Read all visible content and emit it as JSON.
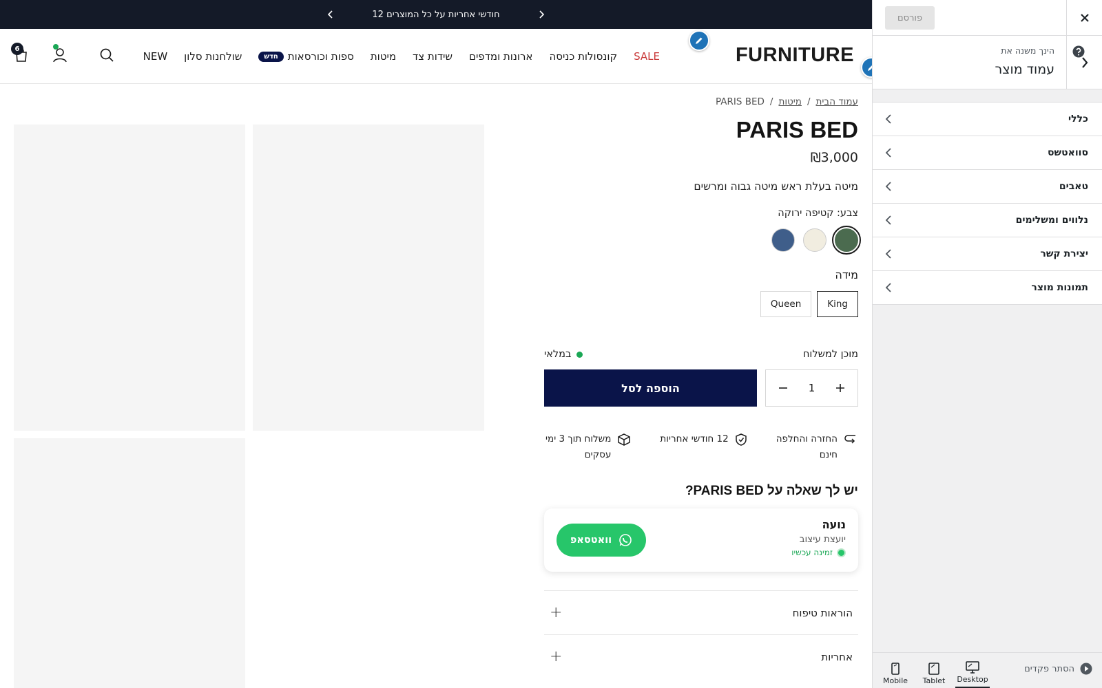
{
  "announcement": {
    "text": "12 חודשי אחריות על כל המוצרים"
  },
  "header": {
    "logo": "FURNITURE",
    "nav": [
      {
        "label": "NEW",
        "sale": false
      },
      {
        "label": "שולחנות סלון",
        "sale": false
      },
      {
        "label": "ספות וכורסאות",
        "sale": false,
        "badge": "חדש"
      },
      {
        "label": "מיטות",
        "sale": false
      },
      {
        "label": "שידות צד",
        "sale": false
      },
      {
        "label": "ארונות ומדפים",
        "sale": false
      },
      {
        "label": "קונסולות כניסה",
        "sale": false
      },
      {
        "label": "SALE",
        "sale": true
      }
    ],
    "cart_count": "6"
  },
  "product": {
    "breadcrumb": {
      "home": "עמוד הבית",
      "category": "מיטות",
      "current": "PARIS BED"
    },
    "title": "PARIS BED",
    "price": "₪3,000",
    "description": "מיטה בעלת ראש מיטה גבוה ומרשים",
    "color_label": "צבע: קטיפה ירוקה",
    "swatches": [
      "#4b6b4f",
      "#f1ede0",
      "#3f5e8a"
    ],
    "size_label": "מידה",
    "sizes": [
      {
        "label": "King",
        "selected": true
      },
      {
        "label": "Queen",
        "selected": false
      }
    ],
    "ship_status": "מוכן למשלוח",
    "stock_status": "במלאי",
    "quantity": "1",
    "add_to_cart": "הוספה לסל",
    "features": [
      {
        "line1": "החזרה והחלפה",
        "line2": "חינם",
        "icon": "return-icon"
      },
      {
        "line1": "12 חודשי אחריות",
        "line2": "",
        "icon": "shield-check-icon"
      },
      {
        "line1": "משלוח תוך 3 ימי",
        "line2": "עסקים",
        "icon": "box-icon"
      }
    ],
    "qa_title": "יש לך שאלה על PARIS BED?",
    "advisor": {
      "name": "נועה",
      "role": "יועצת עיצוב",
      "status": "זמינה עכשיו",
      "button": "וואטסאפ"
    },
    "accordions": [
      "הוראות טיפוח",
      "אחריות"
    ]
  },
  "panel": {
    "publish": "פורסם",
    "editing_label": "הינך משנה את",
    "editing_title": "עמוד מוצר",
    "items": [
      "כללי",
      "סוואטשס",
      "טאבים",
      "נלווים ומשלימים",
      "יצירת קשר",
      "תמונות מוצר"
    ],
    "hide_controls": "הסתר פקדים",
    "devices": [
      {
        "label": "Desktop",
        "active": true
      },
      {
        "label": "Tablet",
        "active": false
      },
      {
        "label": "Mobile",
        "active": false
      }
    ]
  },
  "colors": {
    "navy": "#0a1449",
    "topbar": "#141a28",
    "sale": "#c93a3a",
    "green": "#27c66a",
    "edit_blue": "#1f73b7"
  }
}
